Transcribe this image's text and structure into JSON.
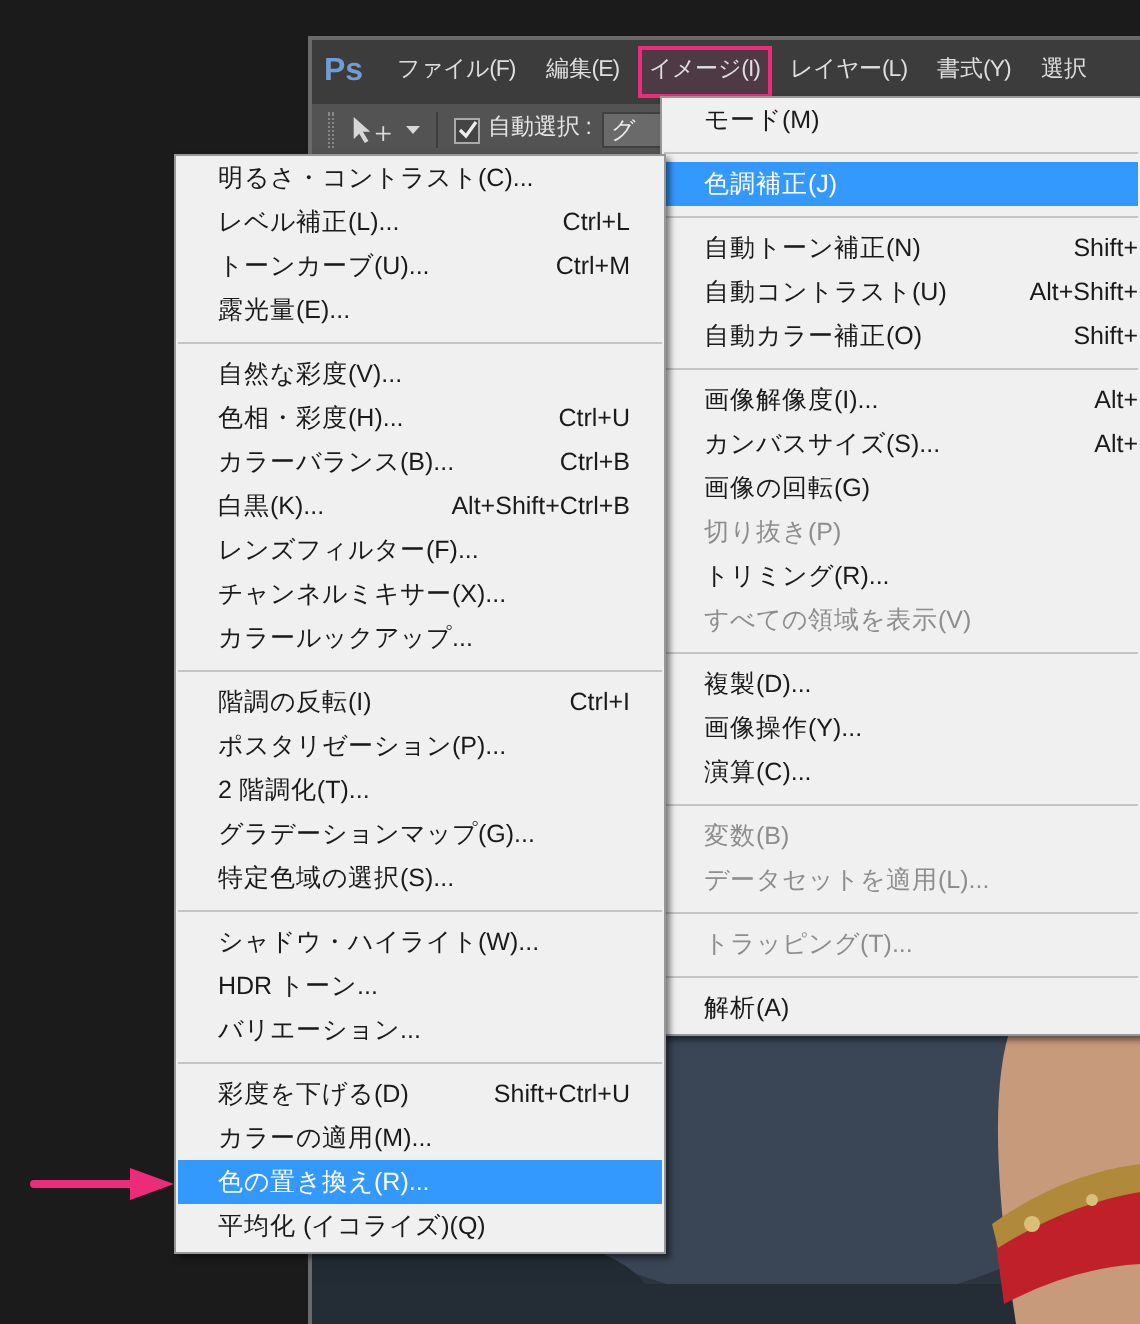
{
  "menubar": {
    "logo": "Ps",
    "items": [
      {
        "label": "ファイル(F)",
        "selected": false
      },
      {
        "label": "編集(E)",
        "selected": false
      },
      {
        "label": "イメージ(I)",
        "selected": true
      },
      {
        "label": "レイヤー(L)",
        "selected": false
      },
      {
        "label": "書式(Y)",
        "selected": false
      },
      {
        "label": "選択",
        "selected": false
      }
    ]
  },
  "toolbar": {
    "auto_select": {
      "label": "自動選択 :",
      "checked": true
    },
    "field": {
      "value": "グ"
    }
  },
  "image_menu": {
    "items": [
      {
        "kind": "item",
        "label": "モード(M)",
        "selected": false,
        "disabled": false
      },
      {
        "kind": "separator"
      },
      {
        "kind": "item",
        "label": "色調補正(J)",
        "selected": true,
        "disabled": false
      },
      {
        "kind": "separator"
      },
      {
        "kind": "item",
        "label": "自動トーン補正(N)",
        "shortcut": "Shift+",
        "selected": false,
        "disabled": false
      },
      {
        "kind": "item",
        "label": "自動コントラスト(U)",
        "shortcut": "Alt+Shift+",
        "selected": false,
        "disabled": false
      },
      {
        "kind": "item",
        "label": "自動カラー補正(O)",
        "shortcut": "Shift+",
        "selected": false,
        "disabled": false
      },
      {
        "kind": "separator"
      },
      {
        "kind": "item",
        "label": "画像解像度(I)...",
        "shortcut": "Alt+",
        "selected": false,
        "disabled": false
      },
      {
        "kind": "item",
        "label": "カンバスサイズ(S)...",
        "shortcut": "Alt+",
        "selected": false,
        "disabled": false
      },
      {
        "kind": "item",
        "label": "画像の回転(G)",
        "selected": false,
        "disabled": false
      },
      {
        "kind": "item",
        "label": "切り抜き(P)",
        "selected": false,
        "disabled": true
      },
      {
        "kind": "item",
        "label": "トリミング(R)...",
        "selected": false,
        "disabled": false
      },
      {
        "kind": "item",
        "label": "すべての領域を表示(V)",
        "selected": false,
        "disabled": true
      },
      {
        "kind": "separator"
      },
      {
        "kind": "item",
        "label": "複製(D)...",
        "selected": false,
        "disabled": false
      },
      {
        "kind": "item",
        "label": "画像操作(Y)...",
        "selected": false,
        "disabled": false
      },
      {
        "kind": "item",
        "label": "演算(C)...",
        "selected": false,
        "disabled": false
      },
      {
        "kind": "separator"
      },
      {
        "kind": "item",
        "label": "変数(B)",
        "selected": false,
        "disabled": true
      },
      {
        "kind": "item",
        "label": "データセットを適用(L)...",
        "selected": false,
        "disabled": true
      },
      {
        "kind": "separator"
      },
      {
        "kind": "item",
        "label": "トラッピング(T)...",
        "selected": false,
        "disabled": true
      },
      {
        "kind": "separator"
      },
      {
        "kind": "item",
        "label": "解析(A)",
        "selected": false,
        "disabled": false
      }
    ]
  },
  "adjustments_menu": {
    "items": [
      {
        "kind": "item",
        "label": "明るさ・コントラスト(C)...",
        "selected": false
      },
      {
        "kind": "item",
        "label": "レベル補正(L)...",
        "shortcut": "Ctrl+L",
        "selected": false
      },
      {
        "kind": "item",
        "label": "トーンカーブ(U)...",
        "shortcut": "Ctrl+M",
        "selected": false
      },
      {
        "kind": "item",
        "label": "露光量(E)...",
        "selected": false
      },
      {
        "kind": "separator"
      },
      {
        "kind": "item",
        "label": "自然な彩度(V)...",
        "selected": false
      },
      {
        "kind": "item",
        "label": "色相・彩度(H)...",
        "shortcut": "Ctrl+U",
        "selected": false
      },
      {
        "kind": "item",
        "label": "カラーバランス(B)...",
        "shortcut": "Ctrl+B",
        "selected": false
      },
      {
        "kind": "item",
        "label": "白黒(K)...",
        "shortcut": "Alt+Shift+Ctrl+B",
        "selected": false
      },
      {
        "kind": "item",
        "label": "レンズフィルター(F)...",
        "selected": false
      },
      {
        "kind": "item",
        "label": "チャンネルミキサー(X)...",
        "selected": false
      },
      {
        "kind": "item",
        "label": "カラールックアップ...",
        "selected": false
      },
      {
        "kind": "separator"
      },
      {
        "kind": "item",
        "label": "階調の反転(I)",
        "shortcut": "Ctrl+I",
        "selected": false
      },
      {
        "kind": "item",
        "label": "ポスタリゼーション(P)...",
        "selected": false
      },
      {
        "kind": "item",
        "label": "2 階調化(T)...",
        "selected": false
      },
      {
        "kind": "item",
        "label": "グラデーションマップ(G)...",
        "selected": false
      },
      {
        "kind": "item",
        "label": "特定色域の選択(S)...",
        "selected": false
      },
      {
        "kind": "separator"
      },
      {
        "kind": "item",
        "label": "シャドウ・ハイライト(W)...",
        "selected": false
      },
      {
        "kind": "item",
        "label": "HDR トーン...",
        "selected": false
      },
      {
        "kind": "item",
        "label": "バリエーション...",
        "selected": false
      },
      {
        "kind": "separator"
      },
      {
        "kind": "item",
        "label": "彩度を下げる(D)",
        "shortcut": "Shift+Ctrl+U",
        "selected": false
      },
      {
        "kind": "item",
        "label": "カラーの適用(M)...",
        "selected": false
      },
      {
        "kind": "item",
        "label": "色の置き換え(R)...",
        "selected": true
      },
      {
        "kind": "item",
        "label": "平均化 (イコライズ)(Q)",
        "selected": false
      }
    ]
  }
}
